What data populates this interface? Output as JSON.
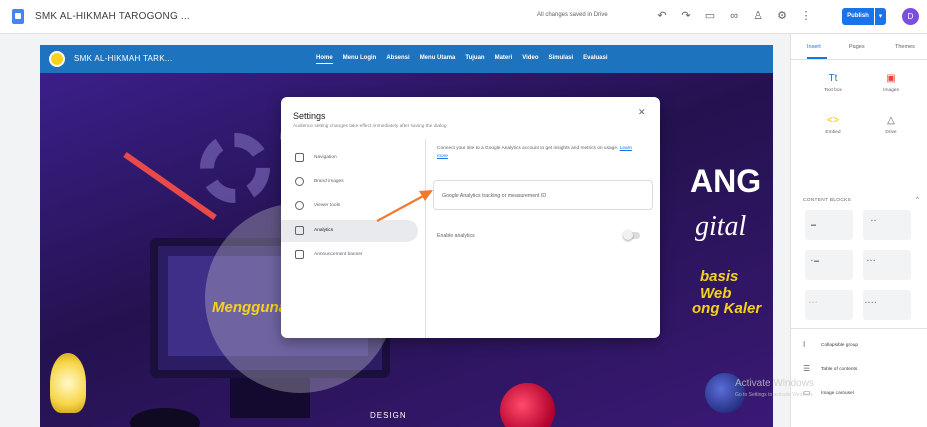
{
  "topbar": {
    "site_name": "SMK AL-HIKMAH TAROGONG ...",
    "saved_status": "All changes saved in Drive",
    "publish_label": "Publish",
    "user_initial": "D",
    "icons": [
      "undo-icon",
      "redo-icon",
      "preview-icon",
      "link-icon",
      "add-person-icon",
      "settings-icon",
      "more-icon"
    ]
  },
  "site": {
    "title": "SMK AL-HIKMAH TARK...",
    "nav": [
      "Home",
      "Menu Login",
      "Absensi",
      "Menu Utama",
      "Tujuan",
      "Materi",
      "Video",
      "Simulasi",
      "Evaluasi"
    ],
    "hero": {
      "ang": "ANG",
      "digital": "gital",
      "web": "basis Web",
      "kaler": "ong Kaler",
      "left": "Menggunakan",
      "design": "DESIGN"
    }
  },
  "settings_dialog": {
    "title": "Settings",
    "subtitle": "Audience setting changes take effect immediately after saving the dialog",
    "menu": [
      {
        "label": "Navigation",
        "active": false
      },
      {
        "label": "Brand images",
        "active": false
      },
      {
        "label": "Viewer tools",
        "active": false
      },
      {
        "label": "Analytics",
        "active": true
      },
      {
        "label": "Announcement banner",
        "active": false
      }
    ],
    "description_text": "Connect your site to a Google Analytics account to get insights and metrics on usage.",
    "description_link": "Learn more",
    "tracking_placeholder": "Google Analytics tracking or measurement ID",
    "enable_label": "Enable analytics",
    "enable_value": false
  },
  "right_panel": {
    "tabs": [
      "Insert",
      "Pages",
      "Themes"
    ],
    "active_tab": "Insert",
    "tools": [
      {
        "label": "Text box",
        "icon": "text-box-icon"
      },
      {
        "label": "Images",
        "icon": "image-icon"
      },
      {
        "label": "Embed",
        "icon": "embed-icon"
      },
      {
        "label": "Drive",
        "icon": "drive-icon"
      }
    ],
    "section_title": "CONTENT BLOCKS",
    "list": [
      {
        "label": "Collapsible group",
        "icon": "collapsible-icon"
      },
      {
        "label": "Table of contents",
        "icon": "toc-icon"
      },
      {
        "label": "Image carousel",
        "icon": "carousel-icon"
      }
    ]
  },
  "watermark": {
    "title": "Activate Windows",
    "subtitle": "Go to Settings to activate Windows."
  },
  "colors": {
    "brand_blue": "#1a73e8",
    "site_nav": "#1e73be",
    "annotation_arrow": "#f07a2c",
    "hero_yellow": "#f6d21d"
  }
}
